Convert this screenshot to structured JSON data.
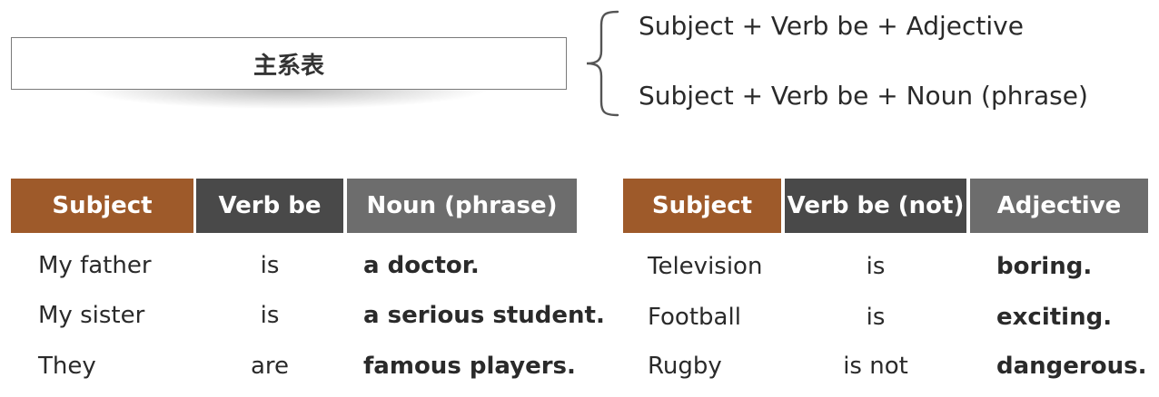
{
  "title": "主系表",
  "patterns": [
    "Subject + Verb be + Adjective",
    "Subject + Verb be + Noun (phrase)"
  ],
  "table_left": {
    "headers": [
      "Subject",
      "Verb be",
      "Noun (phrase)"
    ],
    "rows": [
      [
        "My father",
        "is",
        "a doctor."
      ],
      [
        "My sister",
        "is",
        "a serious student."
      ],
      [
        "They",
        "are",
        "famous players."
      ]
    ]
  },
  "table_right": {
    "headers": [
      "Subject",
      "Verb be (not)",
      "Adjective"
    ],
    "rows": [
      [
        "Television",
        "is",
        "boring."
      ],
      [
        "Football",
        "is",
        "exciting."
      ],
      [
        "Rugby",
        "is not",
        "dangerous."
      ]
    ]
  },
  "colors": {
    "subject_header": "#9e5a2a",
    "verb_header": "#494949",
    "third_header": "#6d6d6d"
  }
}
